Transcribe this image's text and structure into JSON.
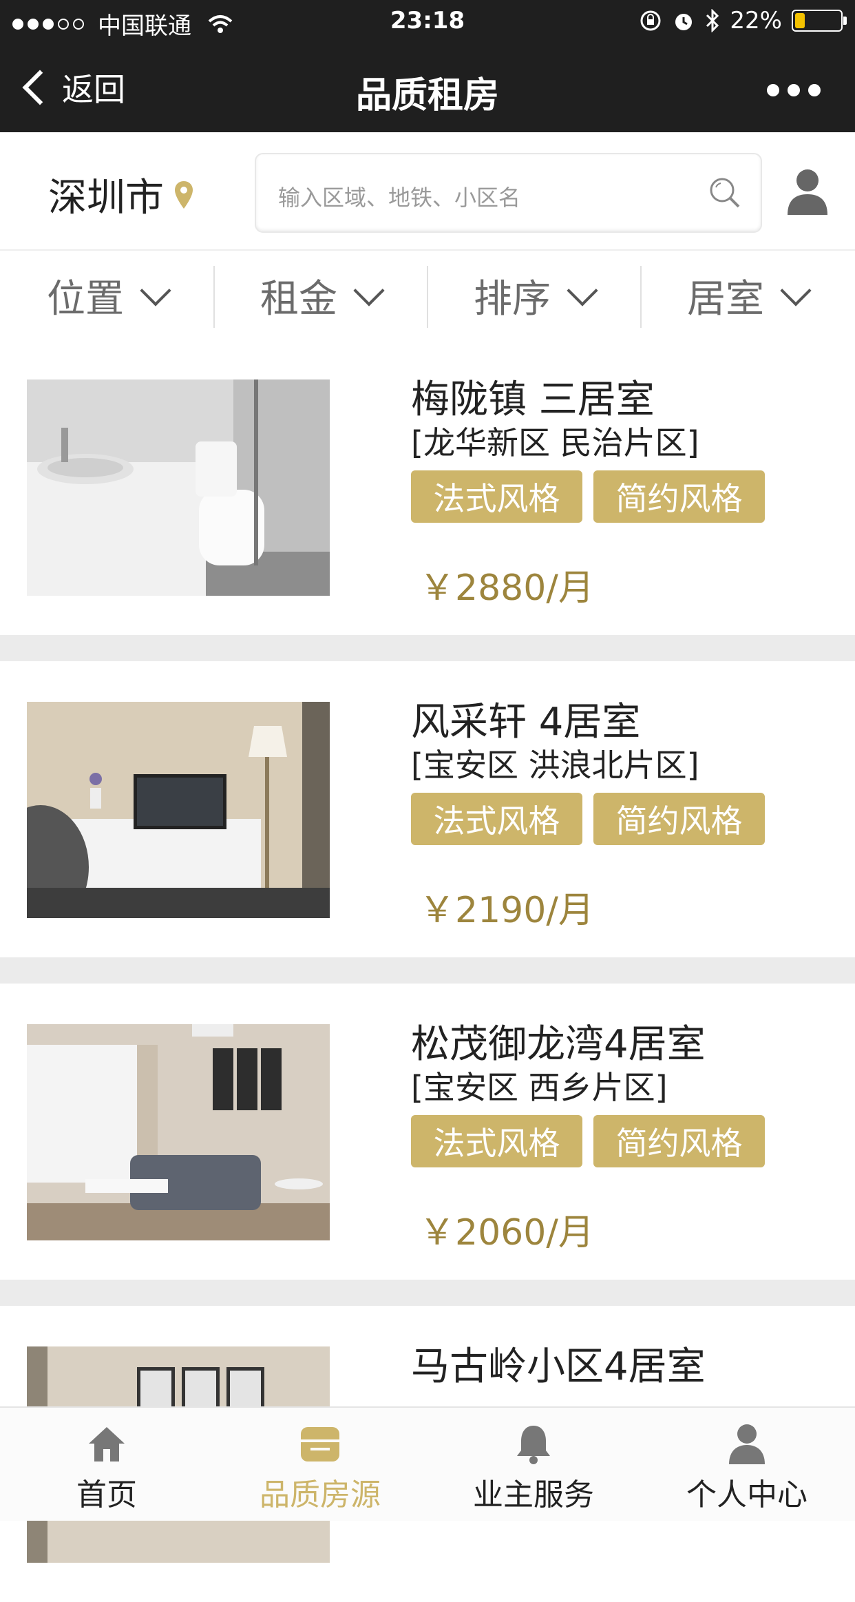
{
  "status_bar": {
    "carrier": "中国联通",
    "time": "23:18",
    "battery": "22%"
  },
  "nav": {
    "back_label": "返回",
    "title": "品质租房"
  },
  "search_bar": {
    "city": "深圳市",
    "placeholder": "输入区域、地铁、小区名"
  },
  "filters": [
    {
      "label": "位置"
    },
    {
      "label": "租金"
    },
    {
      "label": "排序"
    },
    {
      "label": "居室"
    }
  ],
  "listings": [
    {
      "name": "梅陇镇 三居室",
      "area": "[龙华新区 民治片区]",
      "tags": [
        "法式风格",
        "简约风格"
      ],
      "price": "￥2880/月"
    },
    {
      "name": "风采轩 4居室",
      "area": "[宝安区 洪浪北片区]",
      "tags": [
        "法式风格",
        "简约风格"
      ],
      "price": "￥2190/月"
    },
    {
      "name": "松茂御龙湾4居室",
      "area": "[宝安区 西乡片区]",
      "tags": [
        "法式风格",
        "简约风格"
      ],
      "price": "￥2060/月"
    },
    {
      "name": "马古岭小区4居室",
      "area": "",
      "tags": [],
      "price": ""
    }
  ],
  "tabbar": [
    {
      "label": "首页",
      "icon": "home-icon",
      "active": false
    },
    {
      "label": "品质房源",
      "icon": "store-icon",
      "active": true
    },
    {
      "label": "业主服务",
      "icon": "bell-icon",
      "active": false
    },
    {
      "label": "个人中心",
      "icon": "person-icon",
      "active": false
    }
  ],
  "colors": {
    "accent": "#cdb56a",
    "price": "#9d853d",
    "nav_bg": "#1f1f1f"
  }
}
